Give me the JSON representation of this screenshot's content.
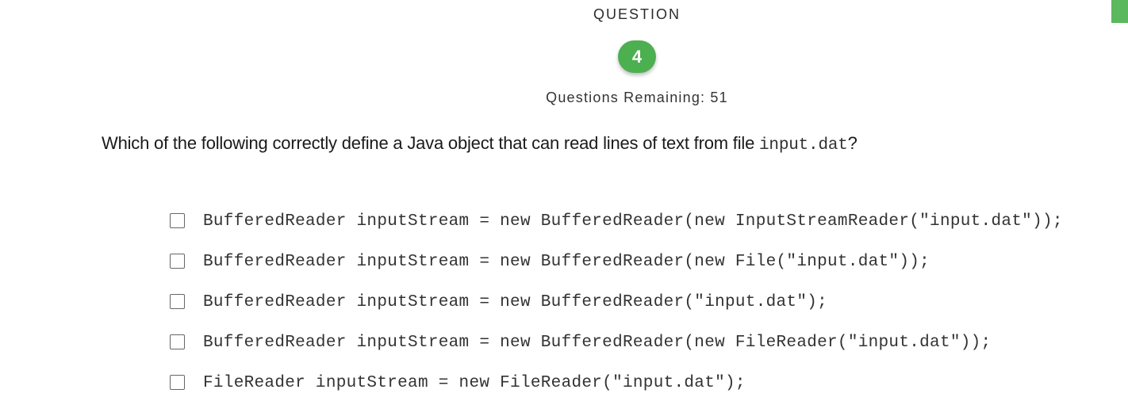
{
  "header": {
    "label": "QUESTION",
    "number": "4",
    "remaining": "Questions Remaining: 51"
  },
  "question": {
    "prefix": "Which of the following correctly define a Java object that can read lines of text from file ",
    "code": "input.dat",
    "suffix": "?"
  },
  "options": [
    {
      "label": "BufferedReader inputStream = new BufferedReader(new InputStreamReader(\"input.dat\"));",
      "checked": false
    },
    {
      "label": "BufferedReader inputStream = new BufferedReader(new File(\"input.dat\"));",
      "checked": false
    },
    {
      "label": "BufferedReader inputStream = new BufferedReader(\"input.dat\");",
      "checked": false
    },
    {
      "label": "BufferedReader inputStream = new BufferedReader(new FileReader(\"input.dat\"));",
      "checked": false
    },
    {
      "label": "FileReader inputStream = new FileReader(\"input.dat\");",
      "checked": false
    }
  ],
  "colors": {
    "accent": "#4caf50",
    "corner": "#5cb85c"
  }
}
